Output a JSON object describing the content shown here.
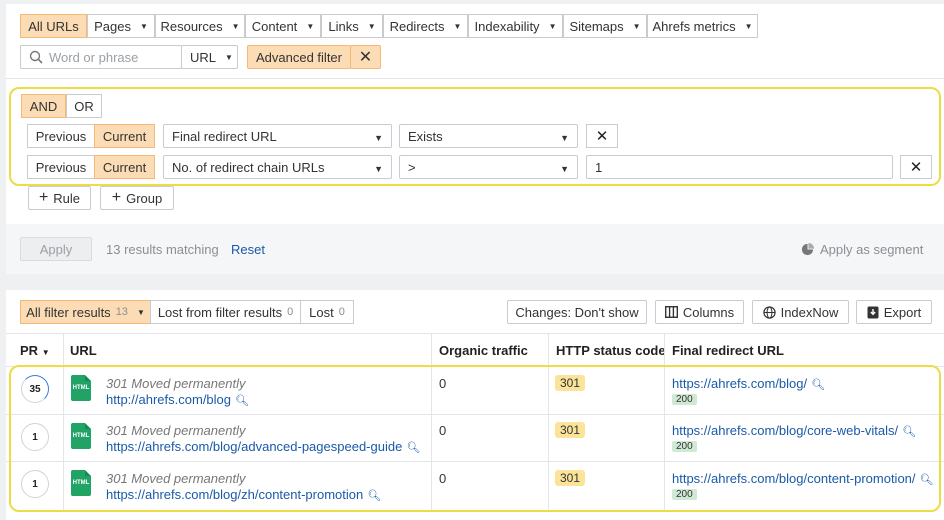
{
  "filters": {
    "tabs": [
      {
        "label": "All URLs",
        "active": true
      },
      {
        "label": "Pages"
      },
      {
        "label": "Resources"
      },
      {
        "label": "Content"
      },
      {
        "label": "Links"
      },
      {
        "label": "Redirects"
      },
      {
        "label": "Indexability"
      },
      {
        "label": "Sitemaps"
      },
      {
        "label": "Ahrefs metrics"
      }
    ],
    "search_placeholder": "Word or phrase",
    "scope_select": "URL",
    "advanced_filter_label": "Advanced filter"
  },
  "builder": {
    "logic_and": "AND",
    "logic_or": "OR",
    "rules": [
      {
        "previous": "Previous",
        "current": "Current",
        "field": "Final redirect URL",
        "operator": "Exists",
        "value": ""
      },
      {
        "previous": "Previous",
        "current": "Current",
        "field": "No. of redirect chain URLs",
        "operator": ">",
        "value": "1"
      }
    ],
    "add_rule": "Rule",
    "add_group": "Group",
    "apply": "Apply",
    "results_matching": "13 results matching",
    "reset": "Reset",
    "apply_segment": "Apply as segment"
  },
  "results_bar": {
    "all_filter_results": "All filter results",
    "all_count": "13",
    "lost_from_filter": "Lost from filter results",
    "lost_from_count": "0",
    "lost": "Lost",
    "lost_count": "0",
    "changes": "Changes: Don't show",
    "columns": "Columns",
    "indexnow": "IndexNow",
    "export": "Export"
  },
  "table": {
    "headers": {
      "pr": "PR",
      "url": "URL",
      "organic": "Organic traffic",
      "status": "HTTP status code",
      "final": "Final redirect URL"
    },
    "rows": [
      {
        "pr": "35",
        "redirect_label": "301 Moved permanently",
        "url": "http://ahrefs.com/blog",
        "organic": "0",
        "status": "301",
        "final_url": "https://ahrefs.com/blog/",
        "final_status": "200"
      },
      {
        "pr": "1",
        "redirect_label": "301 Moved permanently",
        "url": "https://ahrefs.com/blog/advanced-pagespeed-guide",
        "organic": "0",
        "status": "301",
        "final_url": "https://ahrefs.com/blog/core-web-vitals/",
        "final_status": "200"
      },
      {
        "pr": "1",
        "redirect_label": "301 Moved permanently",
        "url": "https://ahrefs.com/blog/zh/content-promotion",
        "organic": "0",
        "status": "301",
        "final_url": "https://ahrefs.com/blog/content-promotion/",
        "final_status": "200"
      }
    ]
  },
  "icons": {
    "file_icon_text": "HTML"
  }
}
